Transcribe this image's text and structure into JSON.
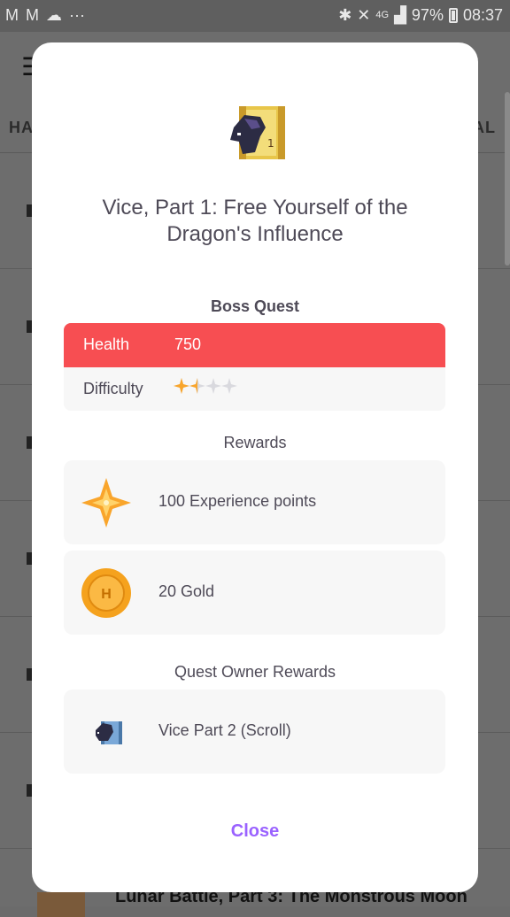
{
  "status_bar": {
    "battery": "97%",
    "time": "08:37",
    "network": "4G"
  },
  "background": {
    "tab_left": "HA",
    "tab_right": "AL",
    "bottom_item_title": "Lunar Battle, Part 3: The Monstrous Moon"
  },
  "dialog": {
    "title": "Vice, Part 1: Free Yourself of the Dragon's Influence",
    "boss_section_label": "Boss Quest",
    "health_label": "Health",
    "health_value": "750",
    "difficulty_label": "Difficulty",
    "difficulty_stars": 1.5,
    "difficulty_max": 4,
    "rewards_label": "Rewards",
    "rewards": [
      {
        "icon": "experience-star-icon",
        "text": "100 Experience points"
      },
      {
        "icon": "gold-coin-icon",
        "text": "20 Gold"
      }
    ],
    "owner_rewards_label": "Quest Owner Rewards",
    "owner_rewards": [
      {
        "icon": "scroll-icon",
        "text": "Vice Part 2 (Scroll)"
      }
    ],
    "close_label": "Close"
  },
  "colors": {
    "health_bar": "#f74e52",
    "accent_purple": "#9a62ff",
    "star_gold": "#f9a52b",
    "card_bg": "#f7f7f7"
  }
}
